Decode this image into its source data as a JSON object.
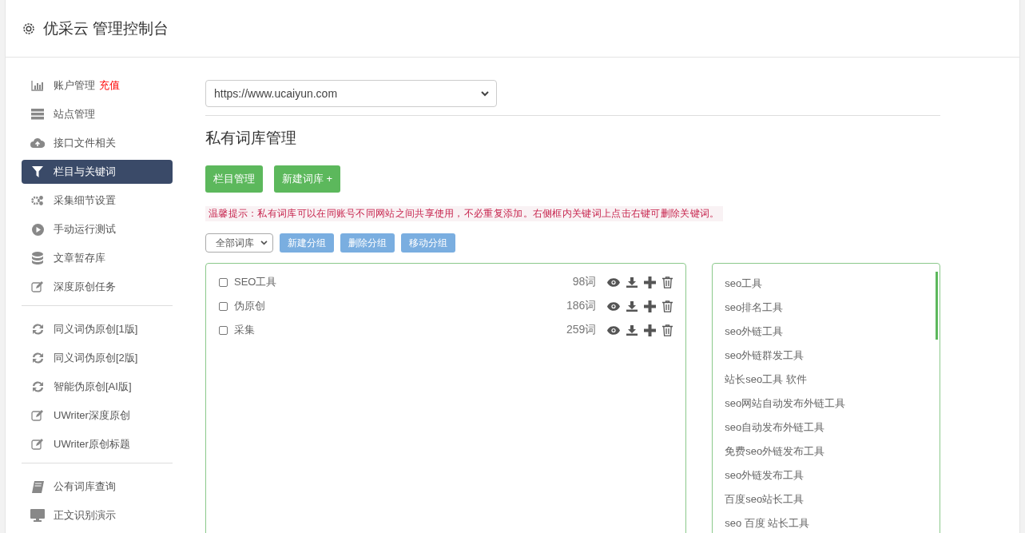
{
  "header": {
    "title": "优采云 管理控制台"
  },
  "sidebar": {
    "groups": [
      [
        {
          "kind": "chart",
          "label": "账户管理",
          "badge": "充值",
          "selected": false
        },
        {
          "kind": "server",
          "label": "站点管理",
          "selected": false
        },
        {
          "kind": "upload",
          "label": "接口文件相关",
          "selected": false
        },
        {
          "kind": "filter",
          "label": "栏目与关键词",
          "selected": true
        },
        {
          "kind": "gears",
          "label": "采集细节设置",
          "selected": false
        },
        {
          "kind": "play",
          "label": "手动运行测试",
          "selected": false
        },
        {
          "kind": "database",
          "label": "文章暂存库",
          "selected": false
        },
        {
          "kind": "edit",
          "label": "深度原创任务",
          "selected": false
        }
      ],
      [
        {
          "kind": "refresh",
          "label": "同义词伪原创[1版]",
          "selected": false
        },
        {
          "kind": "refresh",
          "label": "同义词伪原创[2版]",
          "selected": false
        },
        {
          "kind": "refresh",
          "label": "智能伪原创[AI版]",
          "selected": false
        },
        {
          "kind": "edit",
          "label": "UWriter深度原创",
          "selected": false
        },
        {
          "kind": "edit",
          "label": "UWriter原创标题",
          "selected": false
        }
      ],
      [
        {
          "kind": "book",
          "label": "公有词库查询",
          "selected": false
        },
        {
          "kind": "monitor",
          "label": "正文识别演示",
          "selected": false
        }
      ]
    ]
  },
  "site_select": {
    "value": "https://www.ucaiyun.com"
  },
  "section_title": "私有词库管理",
  "actions": [
    "栏目管理",
    "新建词库 +"
  ],
  "tip": "温馨提示：私有词库可以在同账号不同网站之间共享使用，不必重复添加。右侧框内关键词上点击右键可删除关键词。",
  "library_filter": {
    "value": "全部词库"
  },
  "group_buttons": [
    "新建分组",
    "删除分组",
    "移动分组"
  ],
  "libraries": [
    {
      "label": "SEO工具",
      "count": "98词",
      "checked": false
    },
    {
      "label": "伪原创",
      "count": "186词",
      "checked": false
    },
    {
      "label": "采集",
      "count": "259词",
      "checked": false
    }
  ],
  "keywords": [
    "seo工具",
    "seo排名工具",
    "seo外链工具",
    "seo外链群发工具",
    "站长seo工具 软件",
    "seo网站自动发布外链工具",
    "seo自动发布外链工具",
    "免费seo外链发布工具",
    "seo外链发布工具",
    "百度seo站长工具",
    "seo 百度 站长工具"
  ]
}
